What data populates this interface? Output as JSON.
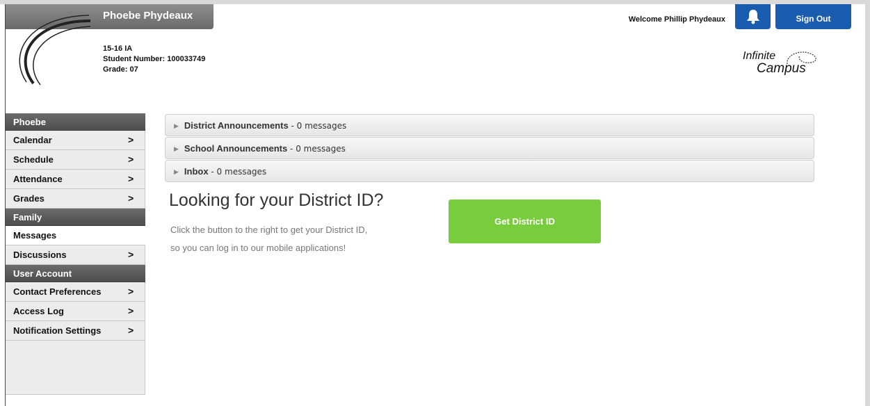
{
  "header": {
    "student_name": "Phoebe Phydeaux",
    "student_info": {
      "year": "15-16 IA",
      "student_number": "Student Number: 100033749",
      "grade": "Grade: 07"
    },
    "welcome_text": "Welcome Phillip Phydeaux",
    "bell_icon": "bell-icon",
    "sign_out_label": "Sign Out",
    "logo": {
      "line1": "Infinite",
      "line2": "Campus"
    },
    "accent_color": "#1a5db0"
  },
  "sidebar": {
    "sections": [
      {
        "title": "Phoebe",
        "items": [
          {
            "label": "Calendar",
            "chevron": ">"
          },
          {
            "label": "Schedule",
            "chevron": ">"
          },
          {
            "label": "Attendance",
            "chevron": ">"
          },
          {
            "label": "Grades",
            "chevron": ">"
          }
        ]
      },
      {
        "title": "Family",
        "items": [
          {
            "label": "Messages",
            "chevron": ""
          },
          {
            "label": "Discussions",
            "chevron": ">"
          }
        ]
      },
      {
        "title": "User Account",
        "items": [
          {
            "label": "Contact Preferences",
            "chevron": ">"
          },
          {
            "label": "Access Log",
            "chevron": ">"
          },
          {
            "label": "Notification Settings",
            "chevron": ">"
          }
        ]
      }
    ]
  },
  "main": {
    "panels": [
      {
        "title": "District Announcements",
        "count": " - 0 messages"
      },
      {
        "title": "School Announcements",
        "count": " - 0 messages"
      },
      {
        "title": "Inbox",
        "count": " - 0 messages"
      }
    ],
    "district": {
      "heading": "Looking for your District ID?",
      "line1": "Click the button to the right to get your District ID,",
      "line2": "so you can log in to our mobile applications!",
      "button_label": "Get District ID",
      "button_color": "#79cc3c"
    }
  }
}
